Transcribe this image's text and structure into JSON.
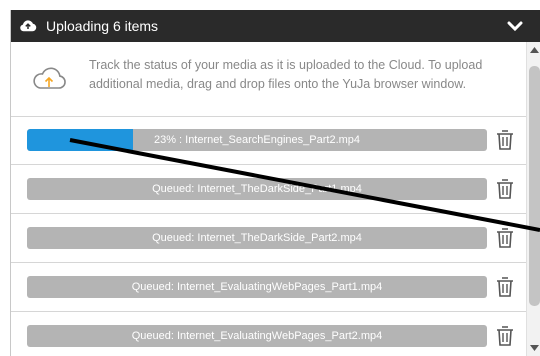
{
  "header": {
    "title": "Uploading 6 items",
    "cloud_icon": "cloud-upload-icon",
    "collapse_icon": "chevron-down-icon"
  },
  "info": {
    "icon": "cloud-upload-outline-icon",
    "text": "Track the status of your media as it is uploaded to the Cloud. To upload additional media, drag and drop files onto the YuJa browser window."
  },
  "uploads": [
    {
      "label": "23% : Internet_SearchEngines_Part2.mp4",
      "progress": 0.23
    },
    {
      "label": "Queued: Internet_TheDarkSide_Part1.mp4",
      "progress": 0
    },
    {
      "label": "Queued: Internet_TheDarkSide_Part2.mp4",
      "progress": 0
    },
    {
      "label": "Queued: Internet_EvaluatingWebPages_Part1.mp4",
      "progress": 0
    },
    {
      "label": "Queued: Internet_EvaluatingWebPages_Part2.mp4",
      "progress": 0
    }
  ],
  "colors": {
    "header_bg": "#2a2a2a",
    "progress_fill": "#1f95dd",
    "bar_bg": "#b4b4b4",
    "icon_accent": "#f5a623"
  }
}
